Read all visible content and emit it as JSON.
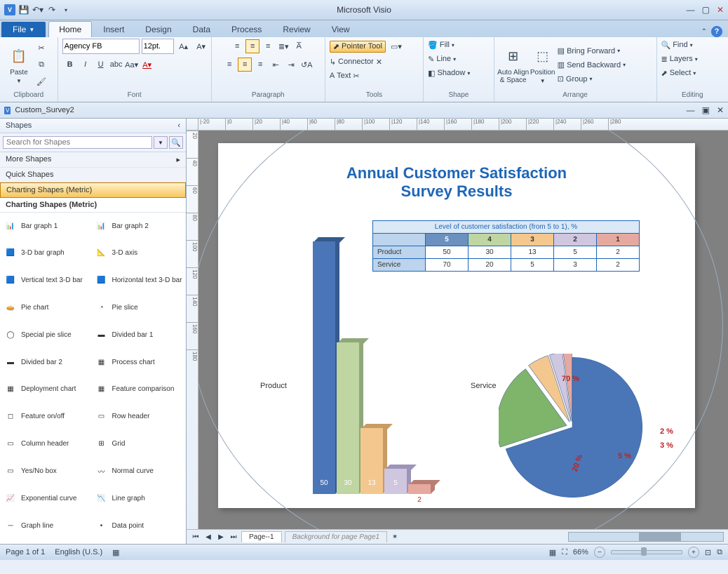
{
  "app_title": "Microsoft Visio",
  "document_name": "Custom_Survey2",
  "tabs": {
    "file": "File",
    "home": "Home",
    "insert": "Insert",
    "design": "Design",
    "data": "Data",
    "process": "Process",
    "review": "Review",
    "view": "View"
  },
  "ribbon": {
    "clipboard": "Clipboard",
    "paste": "Paste",
    "font": "Font",
    "font_name": "Agency FB",
    "font_size": "12pt.",
    "paragraph": "Paragraph",
    "tools": "Tools",
    "pointer": "Pointer Tool",
    "connector": "Connector",
    "text": "Text",
    "shape": "Shape",
    "fill": "Fill",
    "line": "Line",
    "shadow": "Shadow",
    "arrange": "Arrange",
    "autoalign": "Auto Align\n& Space",
    "position": "Position",
    "bring": "Bring Forward",
    "send": "Send Backward",
    "group": "Group",
    "editing": "Editing",
    "find": "Find",
    "layers": "Layers",
    "select": "Select"
  },
  "shapes_panel": {
    "title": "Shapes",
    "search_placeholder": "Search for Shapes",
    "more": "More Shapes",
    "quick": "Quick Shapes",
    "stencil_sel": "Charting Shapes (Metric)",
    "stencil_title": "Charting Shapes (Metric)",
    "items": [
      "Bar graph   1",
      "Bar graph    2",
      "3-D bar graph",
      "3-D axis",
      "Vertical text 3-D bar",
      "Horizontal text 3-D bar",
      "Pie chart",
      "Pie slice",
      "Special pie slice",
      "Divided bar 1",
      "Divided bar 2",
      "Process chart",
      "Deployment chart",
      "Feature comparison",
      "Feature on/off",
      "Row header",
      "Column header",
      "Grid",
      "Yes/No box",
      "Normal curve",
      "Exponential curve",
      "Line graph",
      "Graph line",
      "Data point"
    ]
  },
  "page": {
    "title_l1": "Annual Customer Satisfaction",
    "title_l2": "Survey Results",
    "table_caption": "Level of customer satisfaction (from 5 to 1), %",
    "levels": [
      "5",
      "4",
      "3",
      "2",
      "1"
    ],
    "rows": [
      "Product",
      "Service"
    ],
    "product_label": "Product",
    "service_label": "Service",
    "page_tab": "Page--1",
    "bg_tab": "Background for page Page1"
  },
  "status": {
    "page": "Page 1 of 1",
    "lang": "English (U.S.)",
    "zoom": "66%"
  },
  "chart_data": {
    "table": {
      "caption": "Level of customer satisfaction (from 5 to 1), %",
      "columns": [
        "5",
        "4",
        "3",
        "2",
        "1"
      ],
      "rows": [
        {
          "name": "Product",
          "values": [
            50,
            30,
            13,
            5,
            2
          ]
        },
        {
          "name": "Service",
          "values": [
            70,
            20,
            5,
            3,
            2
          ]
        }
      ]
    },
    "bar": {
      "type": "bar",
      "title": "Product",
      "categories": [
        "5",
        "4",
        "3",
        "2",
        "1"
      ],
      "values": [
        50,
        30,
        13,
        5,
        2
      ],
      "ylim": [
        0,
        50
      ]
    },
    "pie": {
      "type": "pie",
      "title": "Service",
      "categories": [
        "5",
        "4",
        "3",
        "2",
        "1"
      ],
      "values": [
        70,
        20,
        5,
        3,
        2
      ],
      "labels": [
        "70 %",
        "20 %",
        "5 %",
        "3 %",
        "2 %"
      ]
    }
  },
  "ruler_h": [
    "|-20",
    "|0",
    "|20",
    "|40",
    "|60",
    "|80",
    "|100",
    "|120",
    "|140",
    "|160",
    "|180",
    "|200",
    "|220",
    "|240",
    "|260",
    "|280"
  ],
  "ruler_v": [
    "20",
    "40",
    "60",
    "80",
    "100",
    "120",
    "140",
    "160",
    "180"
  ]
}
